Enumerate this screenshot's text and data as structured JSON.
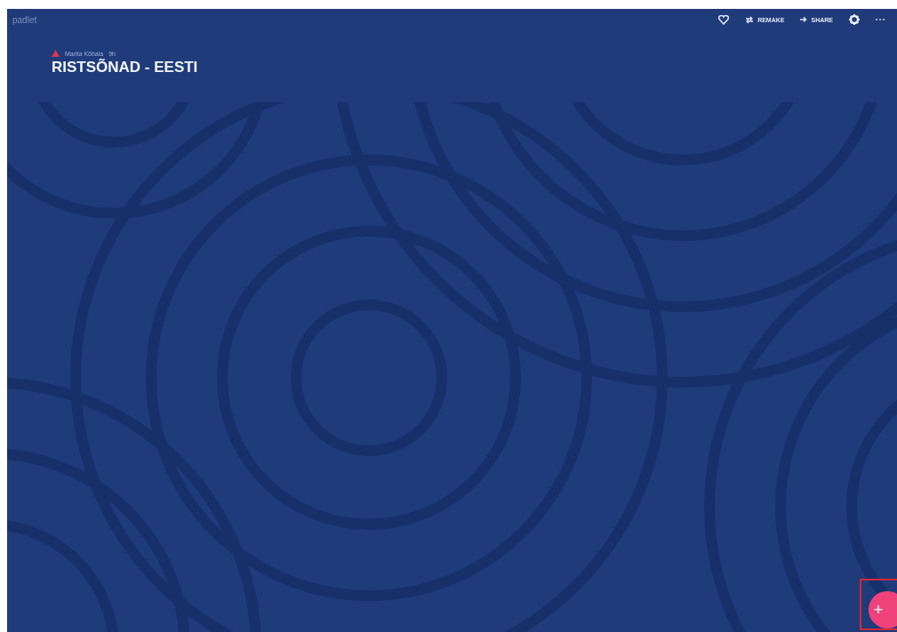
{
  "app": {
    "logo": "padlet"
  },
  "toolbar": {
    "buttons": [
      {
        "kind": "heart"
      },
      {
        "kind": "remake",
        "label": "REMAKE"
      },
      {
        "kind": "share",
        "label": "SHARE"
      },
      {
        "kind": "gear"
      },
      {
        "kind": "more"
      }
    ]
  },
  "board": {
    "author": "Marita Kõbala",
    "time": "9h",
    "title": "RISTSÕNAD - EESTI"
  },
  "fab": {
    "label": "+"
  }
}
